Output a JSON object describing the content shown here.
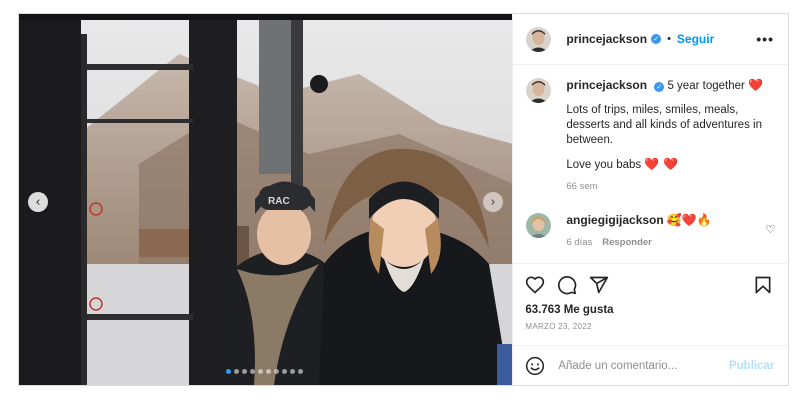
{
  "post": {
    "author": {
      "username": "princejackson",
      "verified": true,
      "follow_label": "Seguir",
      "separator": "•"
    },
    "more_icon": "more-horizontal-icon",
    "caption": {
      "username": "princejackson",
      "title_text": "5 year together",
      "title_emoji": "❤️",
      "paragraph": "Lots of trips, miles, smiles, meals, desserts and all kinds of adventures in between.",
      "closing": "Love you babs",
      "closing_emoji": "❤️ ❤️",
      "age": "66 sem"
    },
    "comments": [
      {
        "username": "angiegigijackson",
        "emoji": "🥰❤️🔥",
        "age": "6 días",
        "reply_label": "Responder"
      }
    ],
    "carousel": {
      "prev_icon": "chevron-left-icon",
      "next_icon": "chevron-right-icon",
      "dot_count": 10,
      "active_index": 0
    },
    "likes": "63.763 Me gusta",
    "date": "MARZO 23, 2022",
    "add_comment": {
      "placeholder": "Añade un comentario...",
      "publish_label": "Publicar"
    },
    "colors": {
      "link_blue": "#0095f6",
      "heart_red": "#ed2c4d",
      "muted": "#8e8e8e"
    }
  }
}
